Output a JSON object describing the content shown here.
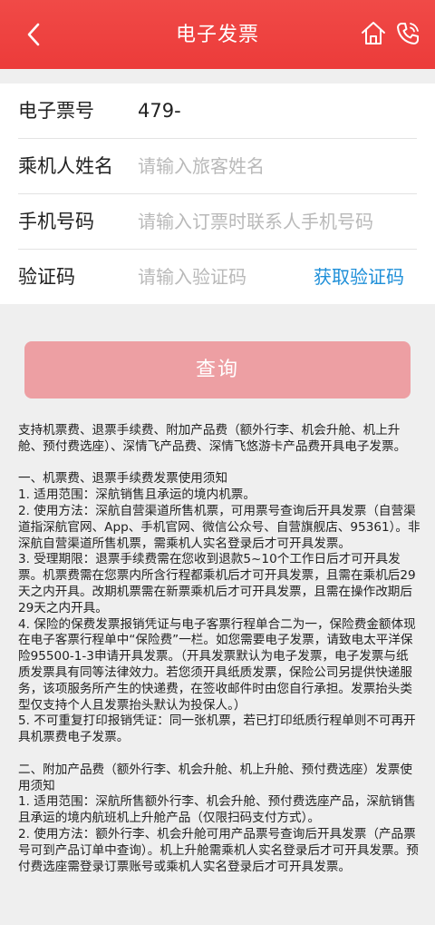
{
  "header": {
    "title": "电子发票",
    "back_icon": "chevron-left-icon",
    "home_icon": "home-icon",
    "phone_icon": "phone-icon"
  },
  "form": {
    "ticket_no": {
      "label": "电子票号",
      "value": "479-"
    },
    "passenger_name": {
      "label": "乘机人姓名",
      "placeholder": "请输入旅客姓名"
    },
    "phone": {
      "label": "手机号码",
      "placeholder": "请输入订票时联系人手机号码"
    },
    "code": {
      "label": "验证码",
      "placeholder": "请输入验证码",
      "get_code_label": "获取验证码"
    }
  },
  "query_button": {
    "label": "查询"
  },
  "notes": [
    "支持机票费、退票手续费、附加产品费（额外行李、机会升舱、机上升舱、预付费选座）、深情飞产品费、深情飞悠游卡产品费开具电子发票。",
    "",
    "一、机票费、退票手续费发票使用须知",
    "1. 适用范围：深航销售且承运的境内机票。",
    "2. 使用方法：深航自营渠道所售机票，可用票号查询后开具发票（自营渠道指深航官网、App、手机官网、微信公众号、自营旗舰店、95361）。非深航自营渠道所售机票，需乘机人实名登录后才可开具发票。",
    "3. 受理期限：退票手续费需在您收到退款5~10个工作日后才可开具发票。机票费需在您票内所含行程都乘机后才可开具发票，且需在乘机后29天之内开具。改期机票需在新票乘机后才可开具发票，且需在操作改期后29天之内开具。",
    "4. 保险的保费发票报销凭证与电子客票行程单合二为一，保险费金额体现在电子客票行程单中“保险费”一栏。如您需要电子发票，请致电太平洋保险95500-1-3申请开具发票。（开具发票默认为电子发票，电子发票与纸质发票具有同等法律效力。若您须开具纸质发票，保险公司另提供快递服务，该项服务所产生的快递费，在签收邮件时由您自行承担。发票抬头类型仅支持个人且发票抬头默认为投保人。）",
    "5. 不可重复打印报销凭证：同一张机票，若已打印纸质行程单则不可再开具机票费电子发票。",
    "",
    "二、附加产品费（额外行李、机会升舱、机上升舱、预付费选座）发票使用须知",
    "1. 适用范围：深航所售额外行李、机会升舱、预付费选座产品，深航销售且承运的境内航班机上升舱产品（仅限扫码支付方式）。",
    "2. 使用方法：额外行李、机会升舱可用产品票号查询后开具发票（产品票号可到产品订单中查询）。机上升舱需乘机人实名登录后才可开具发票。预付费选座需登录订票账号或乘机人实名登录后才可开具发票。"
  ]
}
